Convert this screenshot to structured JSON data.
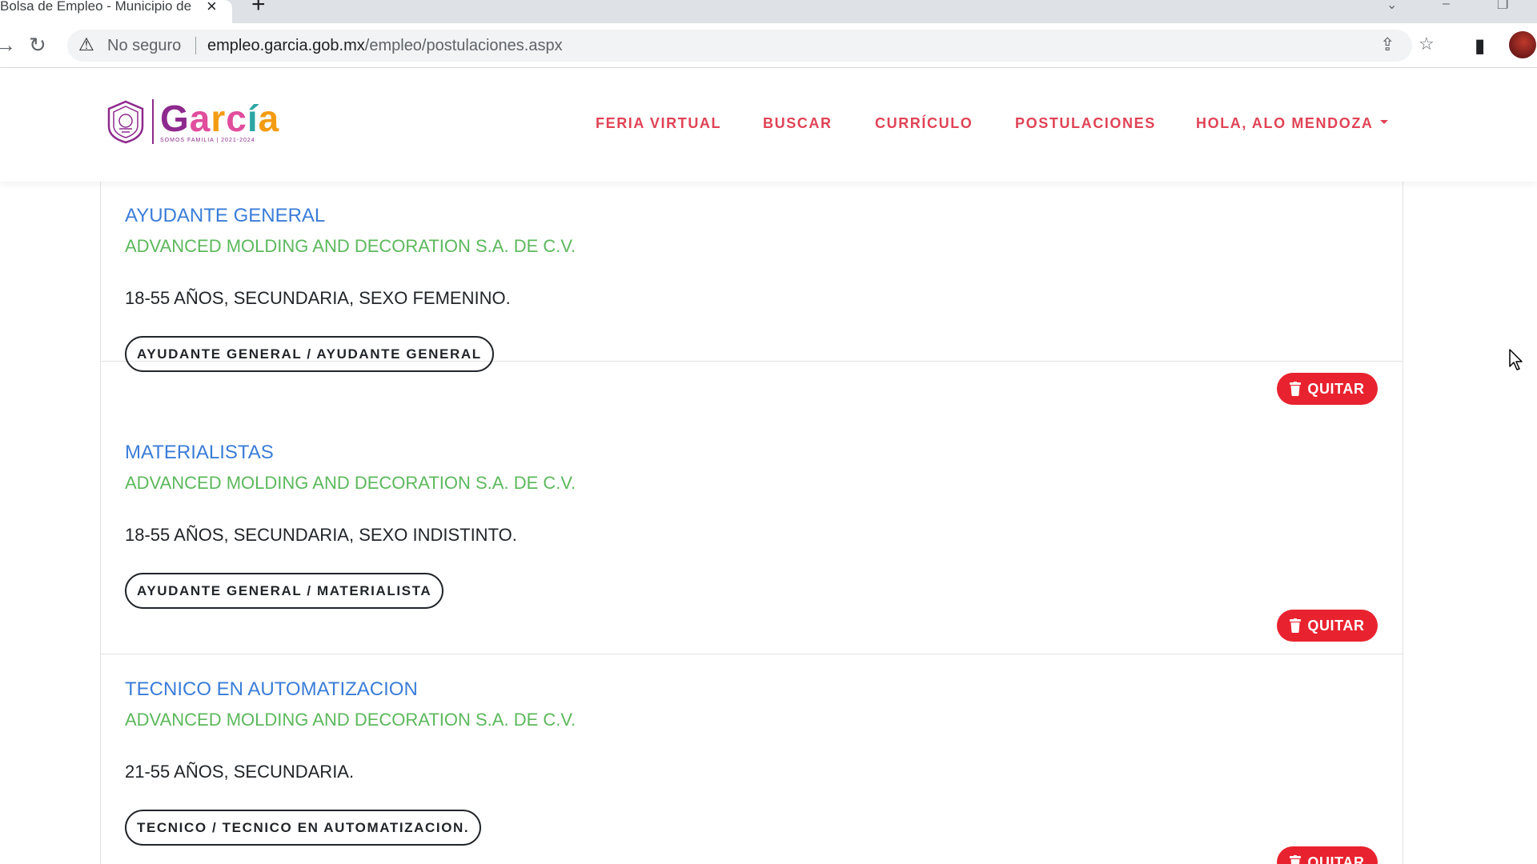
{
  "browser": {
    "tab_title": "Bolsa de Empleo - Municipio de García",
    "insecure_label": "No seguro",
    "url_host": "empleo.garcia.gob.mx",
    "url_path": "/empleo/postulaciones.aspx"
  },
  "site": {
    "logo_word": "García",
    "logo_tagline": "SOMOS FAMILIA | 2021-2024",
    "nav": [
      {
        "label": "FERIA VIRTUAL"
      },
      {
        "label": "BUSCAR"
      },
      {
        "label": "CURRÍCULO"
      },
      {
        "label": "POSTULACIONES"
      },
      {
        "label": "HOLA, ALO MENDOZA"
      }
    ]
  },
  "jobs": [
    {
      "title": "AYUDANTE GENERAL",
      "company": "ADVANCED MOLDING AND DECORATION S.A. DE C.V.",
      "requirements": "18-55 AÑOS, SECUNDARIA, SEXO FEMENINO.",
      "tag": "AYUDANTE GENERAL / AYUDANTE GENERAL",
      "remove_label": "QUITAR"
    },
    {
      "title": "MATERIALISTAS",
      "company": "ADVANCED MOLDING AND DECORATION S.A. DE C.V.",
      "requirements": "18-55 AÑOS, SECUNDARIA, SEXO INDISTINTO.",
      "tag": "AYUDANTE GENERAL / MATERIALISTA",
      "remove_label": "QUITAR"
    },
    {
      "title": "TECNICO EN AUTOMATIZACION",
      "company": "ADVANCED MOLDING AND DECORATION S.A. DE C.V.",
      "requirements": "21-55 AÑOS, SECUNDARIA.",
      "tag": "TECNICO / TECNICO EN AUTOMATIZACION.",
      "remove_label": "QUITAR"
    }
  ],
  "colors": {
    "nav_link": "#e04356",
    "job_title": "#3b7dd8",
    "company": "#5cb85c",
    "remove_button": "#e8232f"
  }
}
